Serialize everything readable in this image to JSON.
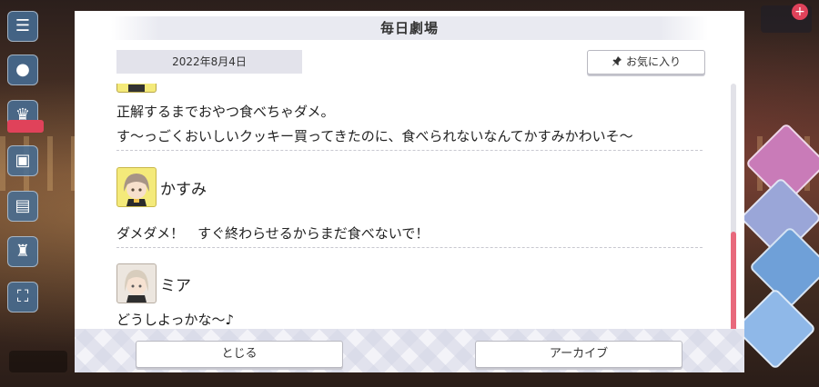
{
  "modal": {
    "title": "毎日劇場",
    "date": "2022年8月4日",
    "favorite_label": "お気に入り"
  },
  "dialogue": {
    "line1": "正解するまでおやつ食べちゃダメ。",
    "line2": "す～っごくおいしいクッキー買ってきたのに、食べられないなんてかすみかわいそ～",
    "speaker2_name": "かすみ",
    "speaker2_line": "ダメダメ！　すぐ終わらせるからまだ食べないで！",
    "speaker3_name": "ミア",
    "speaker3_line": "どうしよっかな～♪"
  },
  "footer": {
    "close_label": "とじる",
    "archive_label": "アーカイブ"
  },
  "colors": {
    "accent_scroll": "#e8697c",
    "kasumi_avatar_bg": "#f4ea7a",
    "mia_avatar_bg": "#ece6df"
  },
  "icons": {
    "favorite": "pin-icon"
  }
}
